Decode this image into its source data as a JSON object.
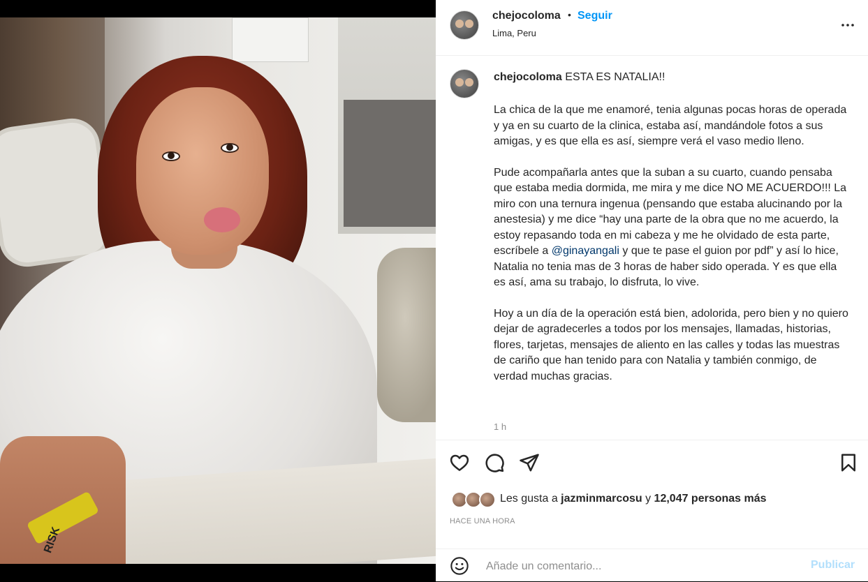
{
  "header": {
    "username": "chejocoloma",
    "separator": "•",
    "follow_label": "Seguir",
    "location": "Lima, Peru"
  },
  "caption": {
    "username": "chejocoloma",
    "headline": "ESTA ES NATALIA!!",
    "paragraph1": "La chica de la que me enamoré, tenia algunas pocas horas de operada y ya en su cuarto de la clinica, estaba así, mandándole fotos a sus amigas, y es que ella es así, siempre verá el vaso medio lleno.",
    "paragraph2_before": "Pude acompañarla antes que la suban a su cuarto, cuando pensaba que estaba media dormida, me mira y me dice NO ME ACUERDO!!! La miro con una ternura ingenua (pensando que estaba alucinando por la anestesia) y me dice “hay una parte de la obra que no me acuerdo, la estoy repasando toda en mi cabeza y me he olvidado de esta parte, escríbele a ",
    "paragraph2_mention": "@ginayangali",
    "paragraph2_after": " y que te pase el guion por pdf” y así lo hice, Natalia no tenia mas de 3 horas de haber sido operada. Y es que ella es así, ama su trabajo, lo disfruta, lo vive.",
    "paragraph3": "Hoy a un día de la operación está bien, adolorida, pero bien y no quiero dejar de agradecerles a todos por los mensajes, llamadas, historias, flores, tarjetas, mensajes de aliento en las calles y todas las muestras de cariño que han tenido para con Natalia y también conmigo, de verdad muchas gracias.",
    "time": "1 h"
  },
  "photo": {
    "wristband_text": "RISK"
  },
  "likes": {
    "prefix": "Les gusta a ",
    "user": "jazminmarcosu",
    "connector": " y ",
    "count_text": "12,047 personas más"
  },
  "posted_ago": "HACE UNA HORA",
  "comment": {
    "placeholder": "Añade un comentario...",
    "publish_label": "Publicar"
  },
  "icons": {
    "more": "more-horizontal-icon",
    "like": "heart-icon",
    "comment": "comment-bubble-icon",
    "share": "paper-plane-icon",
    "save": "bookmark-icon",
    "emoji": "emoji-smile-icon"
  },
  "colors": {
    "link_blue": "#0095f6",
    "publish_disabled": "#b2dffc",
    "mention": "#00376b",
    "muted": "#8e8e8e"
  }
}
